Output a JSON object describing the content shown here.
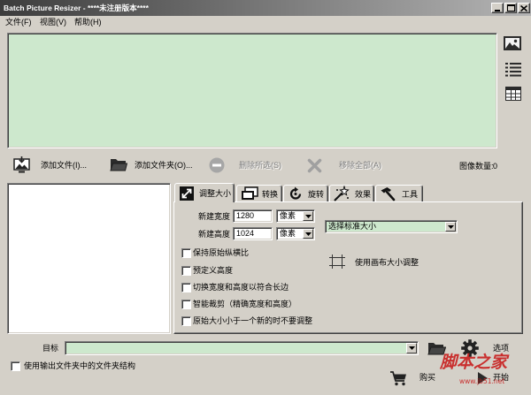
{
  "window": {
    "title": "Batch Picture Resizer - ****未注册版本****"
  },
  "menu": [
    {
      "label": "文件(F)"
    },
    {
      "label": "视图(V)"
    },
    {
      "label": "帮助(H)"
    }
  ],
  "view_buttons": [
    "image-view-icon",
    "list-view-icon",
    "grid-view-icon"
  ],
  "toolbar": {
    "add_files": "添加文件(I)...",
    "add_folder": "添加文件夹(O)...",
    "remove_selected": "删除所选(S)",
    "remove_all": "移除全部(A)",
    "image_count_label": "图像数量:",
    "image_count": "0"
  },
  "tabs": [
    {
      "label": "调整大小",
      "icon": "resize-icon",
      "selected": true
    },
    {
      "label": "转换",
      "icon": "convert-icon",
      "selected": false
    },
    {
      "label": "旋转",
      "icon": "rotate-icon",
      "selected": false
    },
    {
      "label": "效果",
      "icon": "effects-icon",
      "selected": false
    },
    {
      "label": "工具",
      "icon": "tools-icon",
      "selected": false
    }
  ],
  "resize": {
    "width_label": "新建宽度",
    "width_value": "1280",
    "width_unit": "像素",
    "height_label": "新建高度",
    "height_value": "1024",
    "height_unit": "像素",
    "standard_size": "选择标准大小",
    "options": [
      {
        "label": "保持原始纵横比",
        "checked": false
      },
      {
        "label": "预定义高度",
        "checked": false
      },
      {
        "label": "切换宽度和高度以符合长边",
        "checked": false
      },
      {
        "label": "智能裁剪（精确宽度和高度）",
        "checked": false
      },
      {
        "label": "原始大小小于一个新的时不要调整",
        "checked": false
      }
    ],
    "canvas_label": "使用画布大小调整"
  },
  "output": {
    "target_label": "目标",
    "options_label": "选项",
    "keep_structure_label": "使用输出文件夹中的文件夹结构",
    "keep_structure_checked": false
  },
  "actions": {
    "buy_label": "购买",
    "start_label": "开始"
  },
  "watermark": {
    "title": "脚本之家",
    "url": "www.jb51.net"
  },
  "icons": {
    "add_files": "add-file-icon",
    "add_folder": "add-folder-icon",
    "remove_selected": "remove-selected-icon",
    "remove_all": "remove-all-icon",
    "canvas": "canvas-icon",
    "browse": "folder-browse-icon",
    "options": "gear-icon",
    "buy": "cart-icon",
    "start": "play-icon"
  },
  "colors": {
    "window_bg": "#d4d0c8",
    "list_bg": "#cde8cd",
    "title_gradient_start": "#3c3c3c",
    "title_gradient_end": "#b4b4b4",
    "disabled_text": "#808080",
    "watermark": "#c81e1e"
  }
}
